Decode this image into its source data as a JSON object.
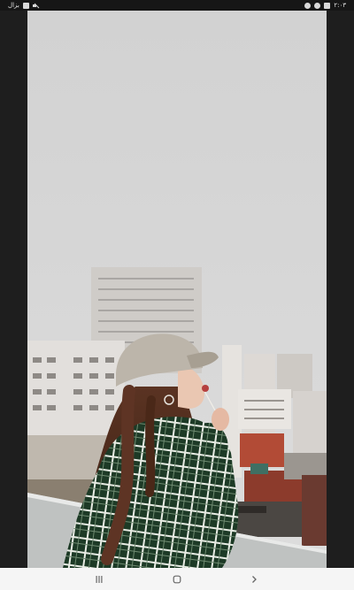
{
  "status_bar": {
    "left_text": "ﺑﺰﺍﻝ",
    "right_text": "۲:۰۳"
  },
  "photo_viewer": {
    "photo_subject": "woman-rooftop-city-photo"
  },
  "navigation": {
    "recents_icon": "recents-icon",
    "home_icon": "home-icon",
    "back_icon": "back-chevron-icon"
  },
  "colors": {
    "sky": "#d3d3d3",
    "status_bar_bg": "#161616",
    "nav_bar_bg": "#f5f5f5",
    "side_bars": "#1e1e1e",
    "flannel_green": "#1f3b26"
  }
}
